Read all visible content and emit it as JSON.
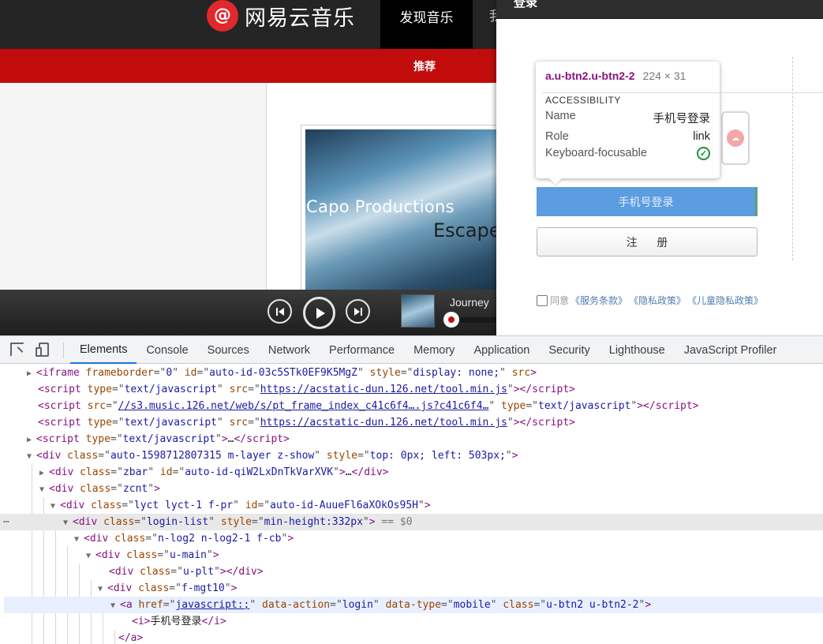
{
  "page": {
    "brand": "网易云音乐",
    "logo_glyph": "@",
    "nav_discover": "发现音乐",
    "nav_next_partial": "我",
    "subnav_recommend": "推荐",
    "album_line1": "Capo Productions",
    "album_line2": "Escape"
  },
  "player": {
    "track_title": "Journey",
    "prev_icon": "prev-icon",
    "play_icon": "play-icon",
    "next_icon": "next-icon"
  },
  "modal": {
    "title": "登录",
    "mobile_login": "手机号登录",
    "register": "注 册",
    "agree_text": "同意",
    "policies": [
      "《服务条款》",
      "《隐私政策》",
      "《儿童隐私政策》"
    ]
  },
  "tooltip": {
    "selector": "a.u-btn2.u-btn2-2",
    "size": "224 × 31",
    "section": "ACCESSIBILITY",
    "rows": [
      {
        "k": "Name",
        "v": "手机号登录"
      },
      {
        "k": "Role",
        "v": "link"
      },
      {
        "k": "Keyboard-focusable",
        "v": ""
      }
    ]
  },
  "devtools": {
    "tabs": [
      "Elements",
      "Console",
      "Sources",
      "Network",
      "Performance",
      "Memory",
      "Application",
      "Security",
      "Lighthouse",
      "JavaScript Profiler"
    ],
    "active_tab": "Elements",
    "accent": "#1a73e8",
    "dom_lines": [
      "iframe frameborder=\"0\" id=\"auto-id-03c5STk0EF9K5MgZ\" style=\"display: none;\" src=\"https://mail.163.com/app/cloudmusic/pro",
      "script type=\"text/javascript\" src=\"https://acstatic-dun.126.net/tool.min.js\"",
      "script src=\"//s3.music.126.net/web/s/pt_frame_index_c41c6f4….js?c41c6f4…\" type=\"text/javascript\"",
      "script type=\"text/javascript\" src=\"https://acstatic-dun.126.net/tool.min.js\"",
      "script type=\"text/javascript\"",
      "div class=\"auto-1598712807315 m-layer z-show\" style=\"top: 0px; left: 503px;\"",
      "div class=\"zbar\" id=\"auto-id-qiW2LxDnTkVarXVK\"",
      "div class=\"zcnt\"",
      "div class=\"lyct lyct-1 f-pr\" id=\"auto-id-AuueFl6aXOkOs95H\"",
      "div class=\"login-list\" style=\"min-height:332px\"",
      "div class=\"n-log2 n-log2-1 f-cb\"",
      "div class=\"u-main\"",
      "div class=\"u-plt\"",
      "div class=\"f-mgt10\"",
      "a href=\"javascript:;\" data-action=\"login\" data-type=\"mobile\" class=\"u-btn2 u-btn2-2\"",
      "<i>手机号登录</i>",
      "</a>"
    ],
    "selected_marker": "== $0"
  }
}
